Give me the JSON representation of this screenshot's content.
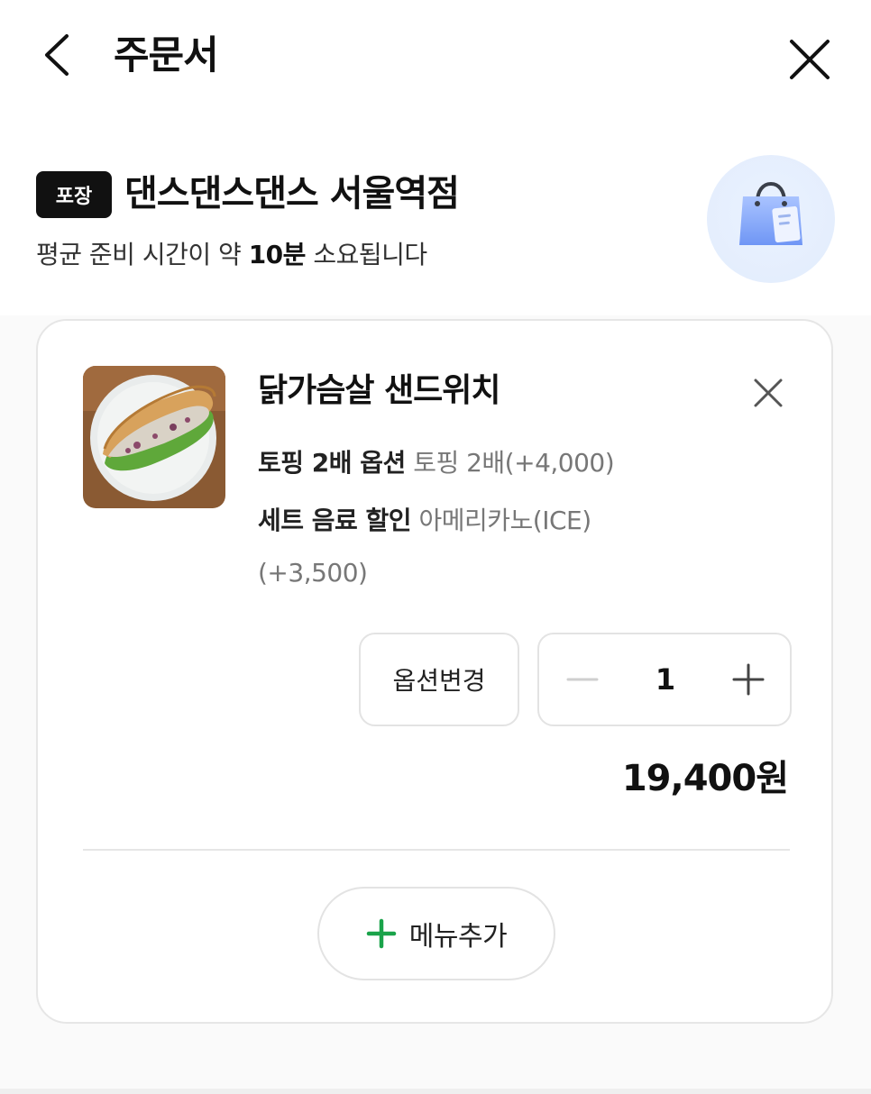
{
  "header": {
    "title": "주문서",
    "back_icon": "chevron-left-icon",
    "close_icon": "close-icon"
  },
  "store": {
    "badge": "포장",
    "name": "댄스댄스댄스 서울역점",
    "prep_prefix": "평균 준비 시간이 약 ",
    "prep_time": "10분",
    "prep_suffix": " 소요됩니다",
    "icon": "shopping-bag-icon"
  },
  "cart": {
    "item": {
      "name": "닭가슴살 샌드위치",
      "options": [
        {
          "label": "토핑 2배 옵션",
          "value": "토핑 2배(+4,000)"
        },
        {
          "label": "세트 음료 할인",
          "value": "아메리카노(ICE)"
        }
      ],
      "option_overflow": "(+3,500)",
      "change_option_label": "옵션변경",
      "quantity": "1",
      "price": "19,400원"
    },
    "add_menu_label": "메뉴추가"
  },
  "colors": {
    "accent_green": "#1aa34a",
    "badge_bg": "#111111",
    "bag_blue": "#7ea6ff"
  }
}
